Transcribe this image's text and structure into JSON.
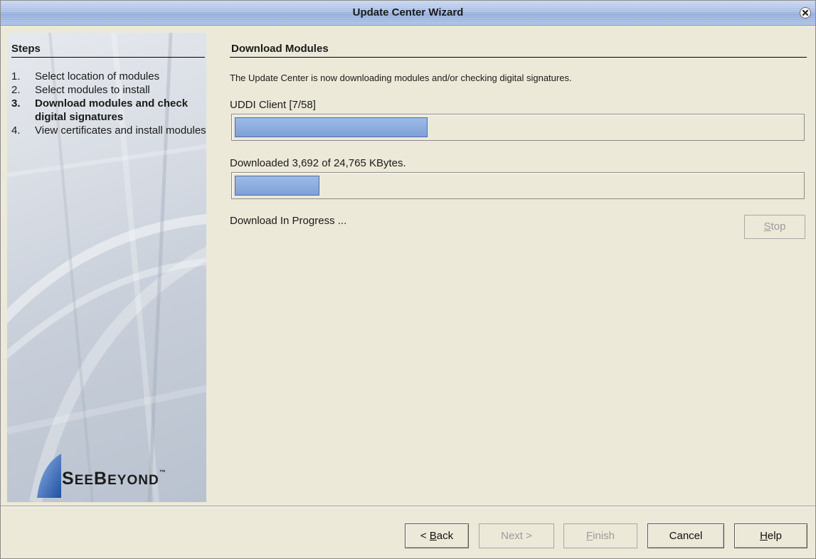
{
  "window": {
    "title": "Update Center Wizard",
    "close_icon": "close-icon"
  },
  "sidebar": {
    "header": "Steps",
    "steps": [
      {
        "num": "1.",
        "label": "Select location of modules",
        "active": false
      },
      {
        "num": "2.",
        "label": "Select modules to install",
        "active": false
      },
      {
        "num": "3.",
        "label": "Download modules and check digital signatures",
        "active": true
      },
      {
        "num": "4.",
        "label": "View certificates and install modules",
        "active": false
      }
    ],
    "logo_text": "SeeBeyond"
  },
  "main": {
    "title": "Download Modules",
    "description": "The Update Center is now downloading modules and/or checking digital signatures.",
    "module_label": "UDDI Client [7/58]",
    "module_progress": 0.34,
    "bytes_label": "Downloaded 3,692 of 24,765 KBytes.",
    "bytes_progress": 0.15,
    "status_text": "Download In Progress ...",
    "stop_button": {
      "prefix": "",
      "mnemonic": "S",
      "suffix": "top",
      "enabled": false
    }
  },
  "footer": {
    "back": {
      "prefix": "< ",
      "mnemonic": "B",
      "suffix": "ack",
      "enabled": true
    },
    "next": {
      "label": "Next >",
      "enabled": false
    },
    "finish": {
      "prefix": "",
      "mnemonic": "F",
      "suffix": "inish",
      "enabled": false
    },
    "cancel": {
      "label": "Cancel",
      "enabled": true
    },
    "help": {
      "prefix": "",
      "mnemonic": "H",
      "suffix": "elp",
      "enabled": true
    }
  },
  "colors": {
    "progress_fill": "#7fa1d8",
    "background": "#ece9d8",
    "title_bar": "#a9bfe4"
  }
}
